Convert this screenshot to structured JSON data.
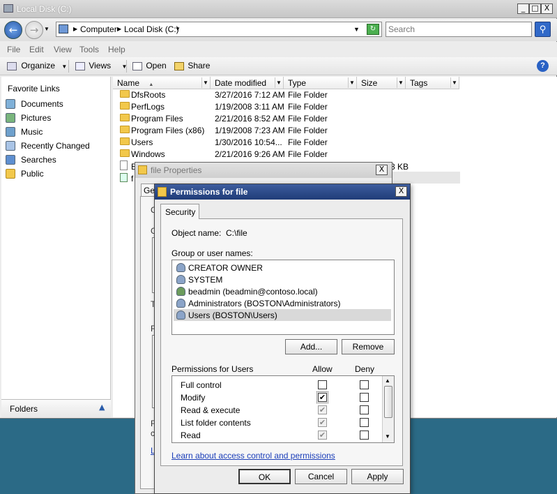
{
  "explorer": {
    "title": "Local Disk (C:)",
    "window_controls": [
      "_",
      "□",
      "X"
    ],
    "address": {
      "segments": [
        "Computer",
        "Local Disk (C:)"
      ]
    },
    "search": {
      "placeholder": "Search"
    },
    "menu": [
      "File",
      "Edit",
      "View",
      "Tools",
      "Help"
    ],
    "toolbar": {
      "organize": "Organize",
      "views": "Views",
      "open": "Open",
      "share": "Share"
    },
    "nav": {
      "heading": "Favorite Links",
      "items": [
        "Documents",
        "Pictures",
        "Music",
        "Recently Changed",
        "Searches",
        "Public"
      ],
      "folders_label": "Folders"
    },
    "columns": [
      "Name",
      "Date modified",
      "Type",
      "Size",
      "Tags"
    ],
    "files": [
      {
        "name": "DfsRoots",
        "date": "3/27/2016 7:12 AM",
        "type": "File Folder"
      },
      {
        "name": "PerfLogs",
        "date": "1/19/2008 3:11 AM",
        "type": "File Folder"
      },
      {
        "name": "Program Files",
        "date": "2/21/2016 8:52 AM",
        "type": "File Folder"
      },
      {
        "name": "Program Files (x86)",
        "date": "1/19/2008 7:23 AM",
        "type": "File Folder"
      },
      {
        "name": "Users",
        "date": "1/30/2016 10:54...",
        "type": "File Folder"
      },
      {
        "name": "Windows",
        "date": "2/21/2016 9:26 AM",
        "type": "File Folder"
      }
    ],
    "partial_rows": [
      "B",
      "f"
    ],
    "partial_size": "3 KB"
  },
  "properties": {
    "title": "file Properties",
    "tab_partial": "Ge",
    "partial_letters": [
      "C",
      "G",
      "T",
      "F",
      "F",
      "c",
      "L"
    ]
  },
  "permissions": {
    "title": "Permissions for file",
    "tab": "Security",
    "object_label": "Object name:",
    "object_value": "C:\\file",
    "group_label": "Group or user names:",
    "users": [
      "CREATOR OWNER",
      "SYSTEM",
      "beadmin (beadmin@contoso.local)",
      "Administrators (BOSTON\\Administrators)",
      "Users (BOSTON\\Users)"
    ],
    "selected_user_index": 4,
    "add_button": "Add...",
    "remove_button": "Remove",
    "perm_header": "Permissions for Users",
    "allow_header": "Allow",
    "deny_header": "Deny",
    "perms": [
      {
        "name": "Full control",
        "allow": false,
        "allow_disabled": false,
        "deny": false
      },
      {
        "name": "Modify",
        "allow": true,
        "allow_disabled": false,
        "deny": false
      },
      {
        "name": "Read & execute",
        "allow": true,
        "allow_disabled": true,
        "deny": false
      },
      {
        "name": "List folder contents",
        "allow": true,
        "allow_disabled": true,
        "deny": false
      },
      {
        "name": "Read",
        "allow": true,
        "allow_disabled": true,
        "deny": false
      }
    ],
    "learn_link": "Learn about access control and permissions",
    "ok": "OK",
    "cancel": "Cancel",
    "apply": "Apply"
  }
}
